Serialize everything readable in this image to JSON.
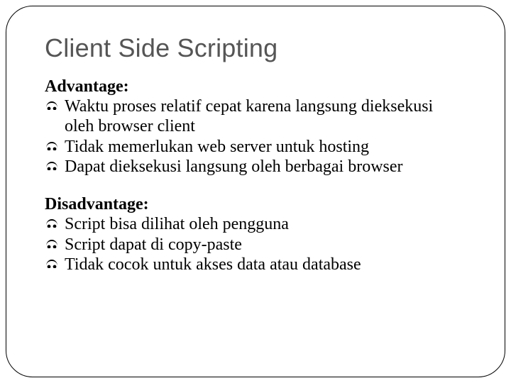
{
  "title": "Client Side Scripting",
  "sections": [
    {
      "heading": "Advantage:",
      "items": [
        "Waktu proses relatif cepat karena langsung dieksekusi oleh browser client",
        "Tidak memerlukan web server untuk hosting",
        "Dapat dieksekusi langsung oleh berbagai browser"
      ]
    },
    {
      "heading": "Disadvantage:",
      "items": [
        "Script bisa dilihat oleh pengguna",
        "Script dapat di copy-paste",
        "Tidak cocok untuk akses data atau database"
      ]
    }
  ]
}
